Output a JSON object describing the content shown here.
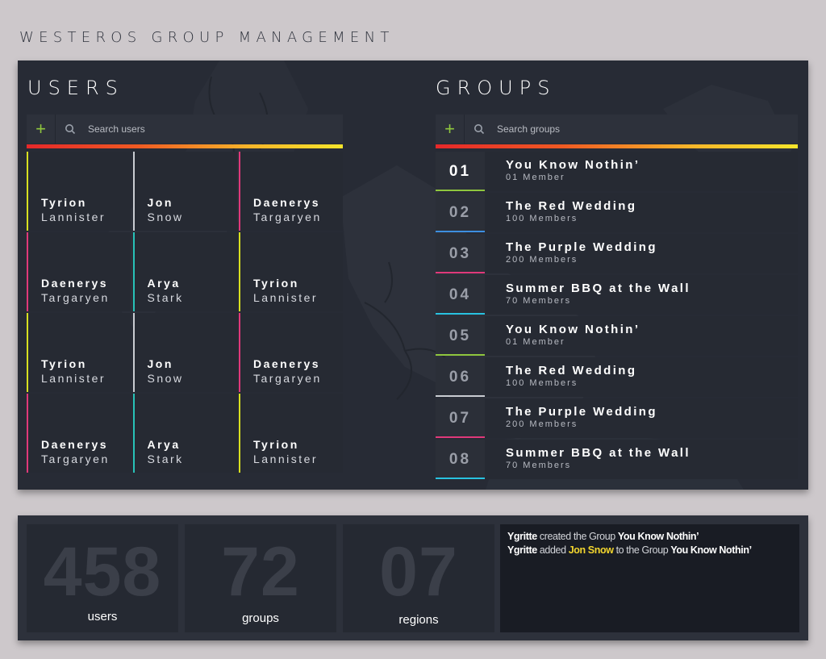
{
  "app_title": "WESTEROS GROUP MANAGEMENT",
  "users": {
    "title": "USERS",
    "add_label": "+",
    "search_placeholder": "Search users",
    "cards": [
      {
        "first": "Tyrion",
        "last": "Lannister",
        "color": "#d8e020"
      },
      {
        "first": "Jon",
        "last": "Snow",
        "color": "#c9ccd2"
      },
      {
        "first": "Daenerys",
        "last": "Targaryen",
        "color": "#e0397a"
      },
      {
        "first": "Daenerys",
        "last": "Targaryen",
        "color": "#e0397a"
      },
      {
        "first": "Arya",
        "last": "Stark",
        "color": "#28c2b8"
      },
      {
        "first": "Tyrion",
        "last": "Lannister",
        "color": "#d8e020"
      },
      {
        "first": "Tyrion",
        "last": "Lannister",
        "color": "#d8e020"
      },
      {
        "first": "Jon",
        "last": "Snow",
        "color": "#c9ccd2"
      },
      {
        "first": "Daenerys",
        "last": "Targaryen",
        "color": "#e0397a"
      },
      {
        "first": "Daenerys",
        "last": "Targaryen",
        "color": "#e0397a"
      },
      {
        "first": "Arya",
        "last": "Stark",
        "color": "#28c2b8"
      },
      {
        "first": "Tyrion",
        "last": "Lannister",
        "color": "#d8e020"
      }
    ]
  },
  "groups": {
    "title": "GROUPS",
    "add_label": "+",
    "search_placeholder": "Search groups",
    "items": [
      {
        "num": "01",
        "name": "You Know Nothin’",
        "members": "01 Member",
        "color": "#8fc63e",
        "active": true
      },
      {
        "num": "02",
        "name": "The Red Wedding",
        "members": "100 Members",
        "color": "#3d8fe0",
        "active": false
      },
      {
        "num": "03",
        "name": "The Purple Wedding",
        "members": "200 Members",
        "color": "#e0397a",
        "active": false
      },
      {
        "num": "04",
        "name": "Summer BBQ at the Wall",
        "members": "70 Members",
        "color": "#28c2e0",
        "active": false
      },
      {
        "num": "05",
        "name": "You Know Nothin’",
        "members": "01 Member",
        "color": "#8fc63e",
        "active": false
      },
      {
        "num": "06",
        "name": "The Red Wedding",
        "members": "100 Members",
        "color": "#c9ccd2",
        "active": false
      },
      {
        "num": "07",
        "name": "The Purple Wedding",
        "members": "200 Members",
        "color": "#e0397a",
        "active": false
      },
      {
        "num": "08",
        "name": "Summer BBQ at the Wall",
        "members": "70 Members",
        "color": "#28c2e0",
        "active": false
      }
    ]
  },
  "stats": [
    {
      "value": "458",
      "label": "users"
    },
    {
      "value": "72",
      "label": "groups"
    },
    {
      "value": "07",
      "label": "regions"
    }
  ],
  "activity": [
    {
      "actor": "Ygritte",
      "text1": " created the Group ",
      "target": "You Know Nothin’"
    },
    {
      "actor": "Ygritte",
      "text1": " added ",
      "user": "Jon Snow",
      "text2": " to the Group ",
      "target": "You Know Nothin’"
    }
  ]
}
